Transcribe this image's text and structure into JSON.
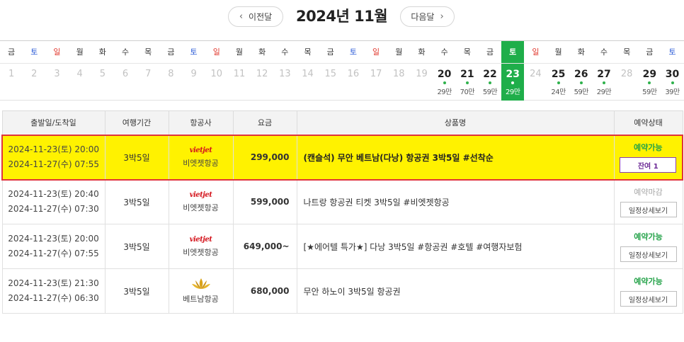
{
  "nav": {
    "prev_label": "이전달",
    "next_label": "다음달",
    "title": "2024년 11월"
  },
  "calendar": {
    "selected_date": "23",
    "selected_color": "#1fae4a",
    "days": [
      {
        "dow": "금",
        "date": "1",
        "type": "weekday",
        "active": false,
        "price": ""
      },
      {
        "dow": "토",
        "date": "2",
        "type": "sat",
        "active": false,
        "price": ""
      },
      {
        "dow": "일",
        "date": "3",
        "type": "sun",
        "active": false,
        "price": ""
      },
      {
        "dow": "월",
        "date": "4",
        "type": "weekday",
        "active": false,
        "price": ""
      },
      {
        "dow": "화",
        "date": "5",
        "type": "weekday",
        "active": false,
        "price": ""
      },
      {
        "dow": "수",
        "date": "6",
        "type": "weekday",
        "active": false,
        "price": ""
      },
      {
        "dow": "목",
        "date": "7",
        "type": "weekday",
        "active": false,
        "price": ""
      },
      {
        "dow": "금",
        "date": "8",
        "type": "weekday",
        "active": false,
        "price": ""
      },
      {
        "dow": "토",
        "date": "9",
        "type": "sat",
        "active": false,
        "price": ""
      },
      {
        "dow": "일",
        "date": "10",
        "type": "sun",
        "active": false,
        "price": ""
      },
      {
        "dow": "월",
        "date": "11",
        "type": "weekday",
        "active": false,
        "price": ""
      },
      {
        "dow": "화",
        "date": "12",
        "type": "weekday",
        "active": false,
        "price": ""
      },
      {
        "dow": "수",
        "date": "13",
        "type": "weekday",
        "active": false,
        "price": ""
      },
      {
        "dow": "목",
        "date": "14",
        "type": "weekday",
        "active": false,
        "price": ""
      },
      {
        "dow": "금",
        "date": "15",
        "type": "weekday",
        "active": false,
        "price": ""
      },
      {
        "dow": "토",
        "date": "16",
        "type": "sat",
        "active": false,
        "price": ""
      },
      {
        "dow": "일",
        "date": "17",
        "type": "sun",
        "active": false,
        "price": ""
      },
      {
        "dow": "월",
        "date": "18",
        "type": "weekday",
        "active": false,
        "price": ""
      },
      {
        "dow": "화",
        "date": "19",
        "type": "weekday",
        "active": false,
        "price": ""
      },
      {
        "dow": "수",
        "date": "20",
        "type": "weekday",
        "active": true,
        "price": "29만"
      },
      {
        "dow": "목",
        "date": "21",
        "type": "weekday",
        "active": true,
        "price": "70만"
      },
      {
        "dow": "금",
        "date": "22",
        "type": "weekday",
        "active": true,
        "price": "59만"
      },
      {
        "dow": "토",
        "date": "23",
        "type": "sat",
        "active": true,
        "price": "29만"
      },
      {
        "dow": "일",
        "date": "24",
        "type": "sun",
        "active": false,
        "price": ""
      },
      {
        "dow": "월",
        "date": "25",
        "type": "weekday",
        "active": true,
        "price": "24만"
      },
      {
        "dow": "화",
        "date": "26",
        "type": "weekday",
        "active": true,
        "price": "59만"
      },
      {
        "dow": "수",
        "date": "27",
        "type": "weekday",
        "active": true,
        "price": "29만"
      },
      {
        "dow": "목",
        "date": "28",
        "type": "weekday",
        "active": false,
        "price": ""
      },
      {
        "dow": "금",
        "date": "29",
        "type": "weekday",
        "active": true,
        "price": "59만"
      },
      {
        "dow": "토",
        "date": "30",
        "type": "sat",
        "active": true,
        "price": "39만"
      }
    ]
  },
  "table": {
    "headers": [
      "출발일/도착일",
      "여행기간",
      "항공사",
      "요금",
      "상품명",
      "예약상태"
    ],
    "rows": [
      {
        "depart": "2024-11-23(토) 20:00",
        "arrive": "2024-11-27(수) 07:55",
        "duration": "3박5일",
        "airline_logo": "vietjet-logo",
        "airline_logo_text": "vietjet",
        "airline": "비엣젯항공",
        "price": "299,000",
        "title": "(캔슬석) 무안 베트남(다낭) 항공권 3박5일 #선착순",
        "status": "예약가능",
        "status_type": "open",
        "button": "잔여 1",
        "button_type": "remain",
        "highlight": true
      },
      {
        "depart": "2024-11-23(토) 20:40",
        "arrive": "2024-11-27(수) 07:30",
        "duration": "3박5일",
        "airline_logo": "vietjet-logo",
        "airline_logo_text": "vietjet",
        "airline": "비엣젯항공",
        "price": "599,000",
        "title": "나트랑 항공권 티켓 3박5일 #비엣젯항공",
        "status": "예약마감",
        "status_type": "closed",
        "button": "일정상세보기",
        "button_type": "detail",
        "highlight": false
      },
      {
        "depart": "2024-11-23(토) 20:00",
        "arrive": "2024-11-27(수) 07:55",
        "duration": "3박5일",
        "airline_logo": "vietjet-logo",
        "airline_logo_text": "vietjet",
        "airline": "비엣젯항공",
        "price": "649,000~",
        "title": "[★에어텔 특가★] 다낭 3박5일 #항공권 #호텔 #여행자보험",
        "status": "예약가능",
        "status_type": "open",
        "button": "일정상세보기",
        "button_type": "detail",
        "highlight": false
      },
      {
        "depart": "2024-11-23(토) 21:30",
        "arrive": "2024-11-27(수) 06:30",
        "duration": "3박5일",
        "airline_logo": "lotus-icon",
        "airline_logo_text": "",
        "airline": "베트남항공",
        "price": "680,000",
        "title": "무안 하노이 3박5일 항공권",
        "status": "예약가능",
        "status_type": "open",
        "button": "일정상세보기",
        "button_type": "detail",
        "highlight": false
      }
    ]
  }
}
